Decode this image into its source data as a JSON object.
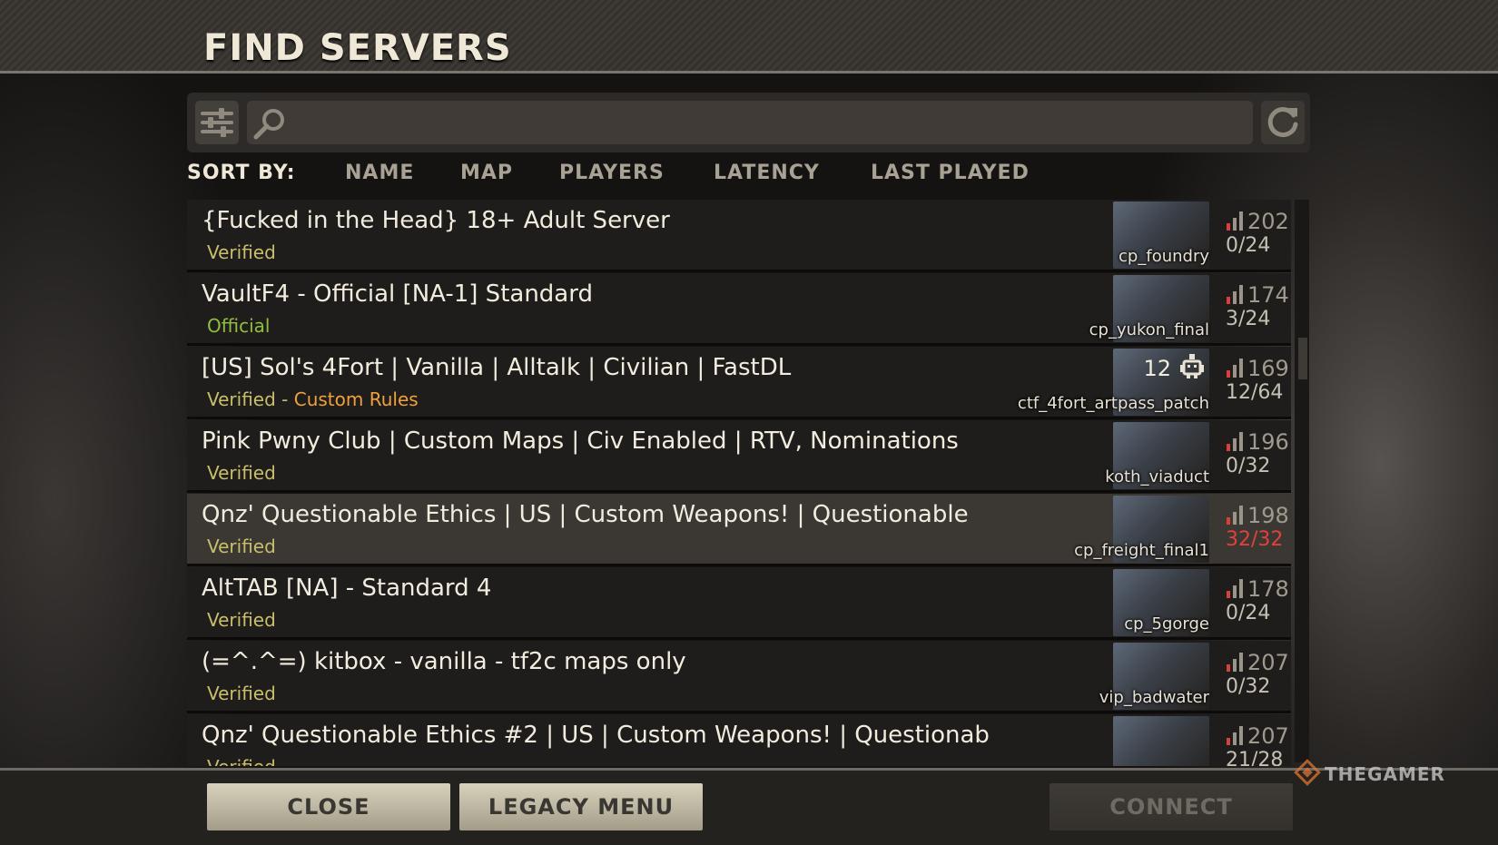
{
  "header": {
    "title": "FIND SERVERS"
  },
  "search": {
    "value": "",
    "placeholder": ""
  },
  "sort": {
    "label": "SORT BY:",
    "options": [
      "NAME",
      "MAP",
      "PLAYERS",
      "LATENCY",
      "LAST PLAYED"
    ]
  },
  "servers": [
    {
      "name": "{Fucked in the Head} 18+ Adult Server",
      "tag": "Verified",
      "tag2": "",
      "map": "cp_foundry",
      "bots": "",
      "ping": "202",
      "players": "0/24",
      "full": false,
      "selected": false
    },
    {
      "name": "VaultF4 - Official [NA-1] Standard",
      "tag": "Official",
      "tag2": "",
      "map": "cp_yukon_final",
      "bots": "",
      "ping": "174",
      "players": "3/24",
      "full": false,
      "selected": false
    },
    {
      "name": "[US] Sol's 4Fort | Vanilla | Alltalk | Civilian | FastDL",
      "tag": "Verified",
      "tag2": "Custom Rules",
      "map": "ctf_4fort_artpass_patch",
      "bots": "12",
      "ping": "169",
      "players": "12/64",
      "full": false,
      "selected": false
    },
    {
      "name": "Pink Pwny Club | Custom Maps | Civ Enabled | RTV, Nominations",
      "tag": "Verified",
      "tag2": "",
      "map": "koth_viaduct",
      "bots": "",
      "ping": "196",
      "players": "0/32",
      "full": false,
      "selected": false
    },
    {
      "name": "Qnz' Questionable Ethics | US | Custom Weapons! | Questionable",
      "tag": "Verified",
      "tag2": "",
      "map": "cp_freight_final1",
      "bots": "",
      "ping": "198",
      "players": "32/32",
      "full": true,
      "selected": true
    },
    {
      "name": " AltTAB [NA] - Standard 4",
      "tag": "Verified",
      "tag2": "",
      "map": "cp_5gorge",
      "bots": "",
      "ping": "178",
      "players": "0/24",
      "full": false,
      "selected": false
    },
    {
      "name": "(=^.^=) kitbox - vanilla - tf2c maps only",
      "tag": "Verified",
      "tag2": "",
      "map": "vip_badwater",
      "bots": "",
      "ping": "207",
      "players": "0/32",
      "full": false,
      "selected": false
    },
    {
      "name": "Qnz' Questionable Ethics #2 | US | Custom Weapons! | Questionab",
      "tag": "Verified",
      "tag2": "",
      "map": "",
      "bots": "",
      "ping": "207",
      "players": "21/28",
      "full": false,
      "selected": false
    }
  ],
  "footer": {
    "close_label": "CLOSE",
    "legacy_label": "LEGACY MENU",
    "connect_label": "CONNECT"
  },
  "watermark": "THEGAMER",
  "colors": {
    "accent_verified": "#c9be6a",
    "accent_official": "#8fbf3e",
    "accent_custom_rules": "#f0a03c",
    "full_server": "#e2413a"
  },
  "icons": [
    "filter-icon",
    "search-icon",
    "refresh-icon",
    "signal-bars-icon",
    "bot-icon"
  ]
}
